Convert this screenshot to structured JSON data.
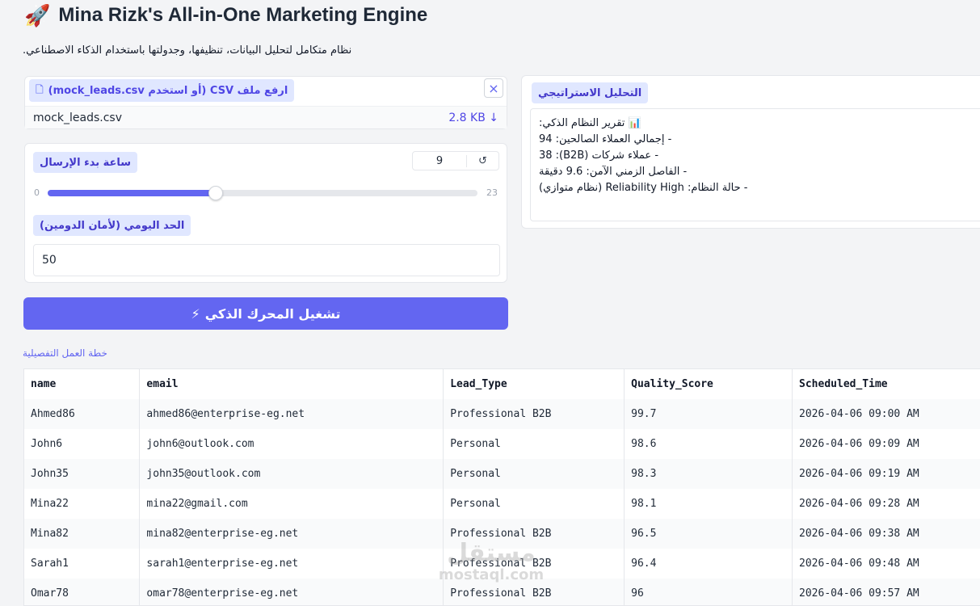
{
  "header": {
    "icon": "rocket-icon",
    "title": "Mina Rizk's All-in-One Marketing Engine",
    "subtitle": "نظام متكامل لتحليل البيانات، تنظيفها، وجدولتها باستخدام الذكاء الاصطناعي."
  },
  "upload": {
    "label": "ارفع ملف CSV (أو استخدم mock_leads.csv)",
    "filename": "mock_leads.csv",
    "filesize": "2.8 KB ↓",
    "close_icon": "×"
  },
  "controls": {
    "hour_label": "ساعة بدء الإرسال",
    "hour_value": "9",
    "hour_reset": "↺",
    "hour_min": "0",
    "hour_max": "23",
    "hour_fraction": 0.3913,
    "limit_label": "الحد اليومي (لأمان الدومين)",
    "limit_value": "50"
  },
  "run_button": {
    "icon": "⚡",
    "label": "تشغيل المحرك الذكي"
  },
  "analysis": {
    "label": "التحليل الاستراتيجي",
    "report_title": "📊 تقرير النظام الذكي:",
    "lines": [
      "- إجمالي العملاء الصالحين: 94",
      "- عملاء شركات (B2B): 38",
      "- الفاصل الزمني الآمن: 9.6 دقيقة",
      "- حالة النظام: Reliability High (نظام متوازي)"
    ]
  },
  "plan": {
    "label": "خطة العمل التفصيلية",
    "columns": [
      "name",
      "email",
      "Lead_Type",
      "Quality_Score",
      "Scheduled_Time"
    ],
    "rows": [
      [
        "Ahmed86",
        "ahmed86@enterprise-eg.net",
        "Professional B2B",
        "99.7",
        "2026-04-06 09:00 AM"
      ],
      [
        "John6",
        "john6@outlook.com",
        "Personal",
        "98.6",
        "2026-04-06 09:09 AM"
      ],
      [
        "John35",
        "john35@outlook.com",
        "Personal",
        "98.3",
        "2026-04-06 09:19 AM"
      ],
      [
        "Mina22",
        "mina22@gmail.com",
        "Personal",
        "98.1",
        "2026-04-06 09:28 AM"
      ],
      [
        "Mina82",
        "mina82@enterprise-eg.net",
        "Professional B2B",
        "96.5",
        "2026-04-06 09:38 AM"
      ],
      [
        "Sarah1",
        "sarah1@enterprise-eg.net",
        "Professional B2B",
        "96.4",
        "2026-04-06 09:48 AM"
      ],
      [
        "Omar78",
        "omar78@enterprise-eg.net",
        "Professional B2B",
        "96",
        "2026-04-06 09:57 AM"
      ]
    ]
  },
  "watermark": {
    "arabic": "مستقل",
    "latin": "mostaql.com"
  },
  "colors": {
    "accent": "#6366f1",
    "pill_bg": "#e0e7ff"
  }
}
